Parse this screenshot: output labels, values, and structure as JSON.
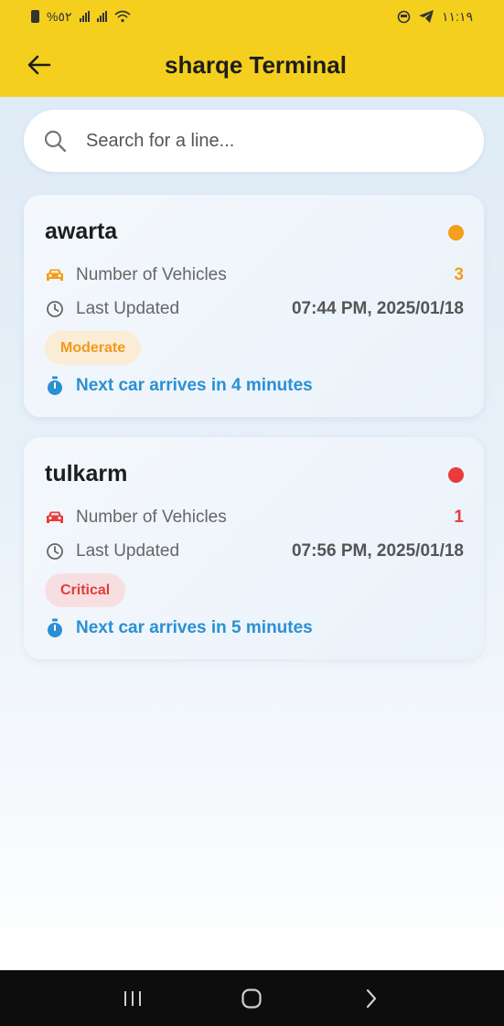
{
  "statusbar": {
    "left_text": "%٥٢",
    "time": "١١:١٩"
  },
  "header": {
    "title": "sharqe Terminal"
  },
  "search": {
    "placeholder": "Search for a line..."
  },
  "lines": [
    {
      "name": "awarta",
      "status_color": "#f59e1b",
      "vehicles_label": "Number of Vehicles",
      "vehicles_count": "3",
      "updated_label": "Last Updated",
      "updated_value": "07:44 PM, 2025/01/18",
      "badge": "Moderate",
      "badge_text_color": "#f29a1a",
      "badge_bg_color": "#fbecd6",
      "eta": "Next car arrives in 4 minutes"
    },
    {
      "name": "tulkarm",
      "status_color": "#ea3b3b",
      "vehicles_label": "Number of Vehicles",
      "vehicles_count": "1",
      "updated_label": "Last Updated",
      "updated_value": "07:56 PM, 2025/01/18",
      "badge": "Critical",
      "badge_text_color": "#e33b3b",
      "badge_bg_color": "#f7dfe1",
      "eta": "Next car arrives in 5 minutes"
    }
  ],
  "icons": {
    "back": "arrow-left-icon",
    "search": "search-icon",
    "car": "car-icon",
    "clock": "clock-icon",
    "timer": "stopwatch-icon"
  },
  "colors": {
    "accent": "#f5cf1e",
    "eta": "#2a90d4"
  }
}
